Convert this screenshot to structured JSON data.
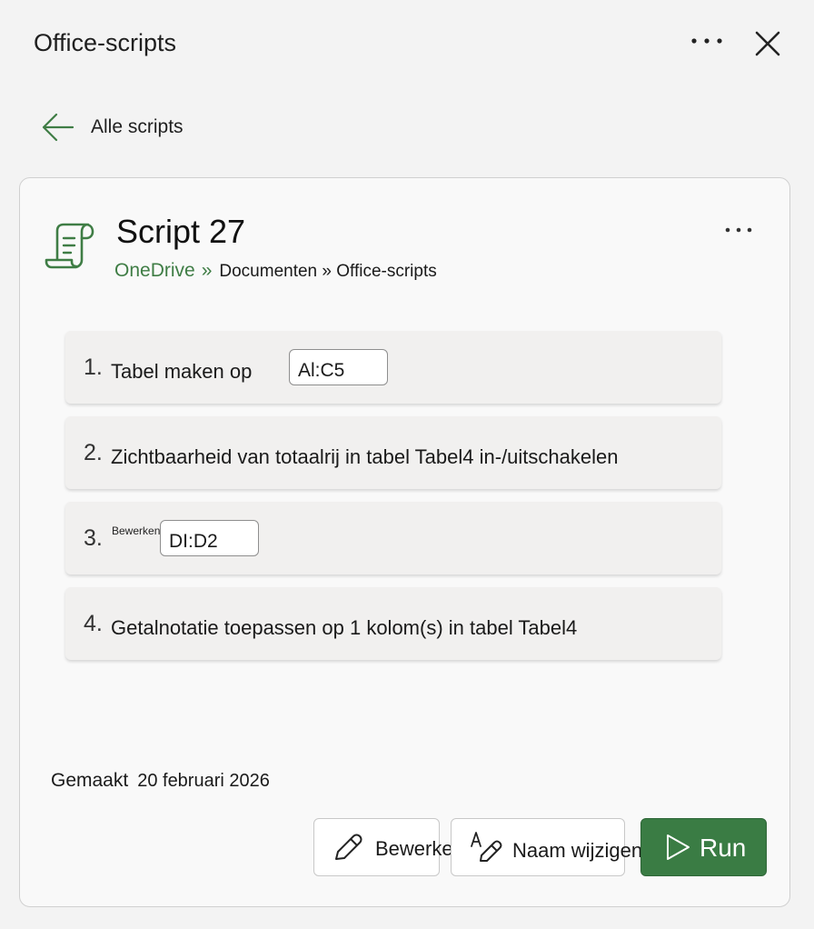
{
  "pane": {
    "title": "Office-scripts",
    "more_icon": "ellipsis-icon",
    "close_icon": "close-icon"
  },
  "back": {
    "label": "Alle scripts",
    "icon": "arrow-left-icon",
    "icon_color": "#3f7d45"
  },
  "script": {
    "title": "Script 27",
    "icon": "script-scroll-icon",
    "breadcrumb_root": "OneDrive",
    "breadcrumb_separator": "»",
    "breadcrumb_rest": "Documenten » Office-scripts"
  },
  "steps": [
    {
      "number": "1.",
      "text": "Tabel maken op",
      "range": "Al:C5"
    },
    {
      "number": "2.",
      "text": "Zichtbaarheid van totaalrij in tabel Tabel4 in-/uitschakelen"
    },
    {
      "number": "3.",
      "label": "Bewerken",
      "range": "DI:D2"
    },
    {
      "number": "4.",
      "text": "Getalnotatie toepassen op 1 kolom(s) in tabel Tabel4"
    }
  ],
  "created": {
    "label": "Gemaakt",
    "date": "20 februari 2026"
  },
  "actions": {
    "edit": {
      "label": "Bewerken",
      "icon": "pencil-icon"
    },
    "rename": {
      "label": "Naam wijzigen",
      "icon": "rename-icon"
    },
    "run": {
      "label": "Run",
      "icon": "play-icon"
    }
  },
  "colors": {
    "accent": "#3a7c44",
    "link_green": "#3f7d45",
    "background": "#f3f3f3",
    "card": "#f9f9f9"
  }
}
